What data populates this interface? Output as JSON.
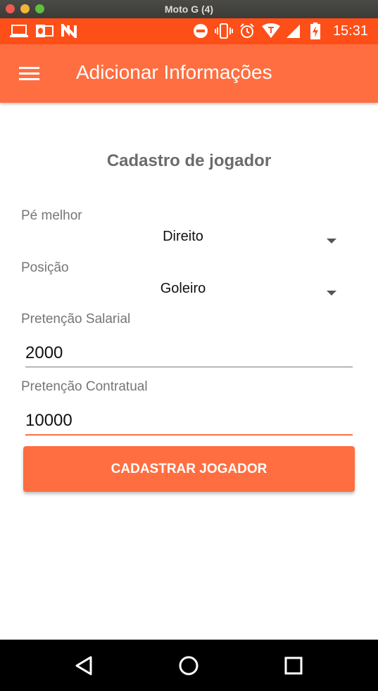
{
  "window": {
    "title": "Moto G (4)"
  },
  "status_bar": {
    "time": "15:31",
    "left_icons": [
      "laptop-icon",
      "outlook-icon",
      "n-app-icon"
    ],
    "right_icons": [
      "do-not-disturb-icon",
      "vibrate-icon",
      "alarm-icon",
      "wifi-icon",
      "signal-icon",
      "battery-charging-icon"
    ]
  },
  "app_bar": {
    "title": "Adicionar Informações",
    "menu_icon": "hamburger-menu-icon"
  },
  "form": {
    "title": "Cadastro de jogador",
    "pe_melhor": {
      "label": "Pé melhor",
      "value": "Direito"
    },
    "posicao": {
      "label": "Posição",
      "value": "Goleiro"
    },
    "pretencao_salarial": {
      "label": "Pretenção Salarial",
      "value": "2000"
    },
    "pretencao_contratual": {
      "label": "Pretenção Contratual",
      "value": "10000"
    },
    "submit_label": "CADASTRAR JOGADOR"
  },
  "colors": {
    "status_bar": "#ff4f18",
    "app_bar": "#ff6e40",
    "accent": "#ff6e40",
    "nav_bar": "#000000"
  },
  "nav_bar": {
    "icons": [
      "back-icon",
      "home-icon",
      "recents-icon"
    ]
  }
}
